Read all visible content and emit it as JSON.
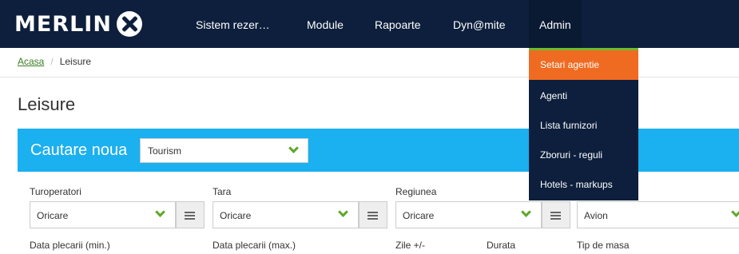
{
  "brand": {
    "name": "MERLIN"
  },
  "nav": {
    "items": [
      "Sistem rezer…",
      "Module",
      "Rapoarte",
      "Dyn@mite"
    ],
    "active": "Admin"
  },
  "breadcrumb": {
    "home": "Acasa",
    "current": "Leisure"
  },
  "page": {
    "title": "Leisure"
  },
  "search": {
    "title": "Cautare noua",
    "type_value": "Tourism"
  },
  "fields": {
    "tour_operators": {
      "label": "Turoperatori",
      "value": "Oricare"
    },
    "country": {
      "label": "Tara",
      "value": "Oricare"
    },
    "region": {
      "label": "Regiunea",
      "value": "Oricare"
    },
    "transport": {
      "value": "Avion"
    },
    "departure_min": {
      "label": "Data plecarii (min.)"
    },
    "departure_max": {
      "label": "Data plecarii (max.)"
    },
    "days": {
      "label": "Zile +/-"
    },
    "duration": {
      "label": "Durata"
    },
    "meal": {
      "label": "Tip de masa"
    }
  },
  "admin_menu": {
    "items": [
      "Setari agentie",
      "Agenti",
      "Lista furnizori",
      "Zboruri - reguli",
      "Hotels - markups"
    ],
    "highlighted": "Setari agentie"
  },
  "colors": {
    "nav_bg": "#0d1f3c",
    "search_bar": "#1bb0ef",
    "accent_green": "#5ea82c",
    "menu_highlight": "#ef6b21"
  }
}
